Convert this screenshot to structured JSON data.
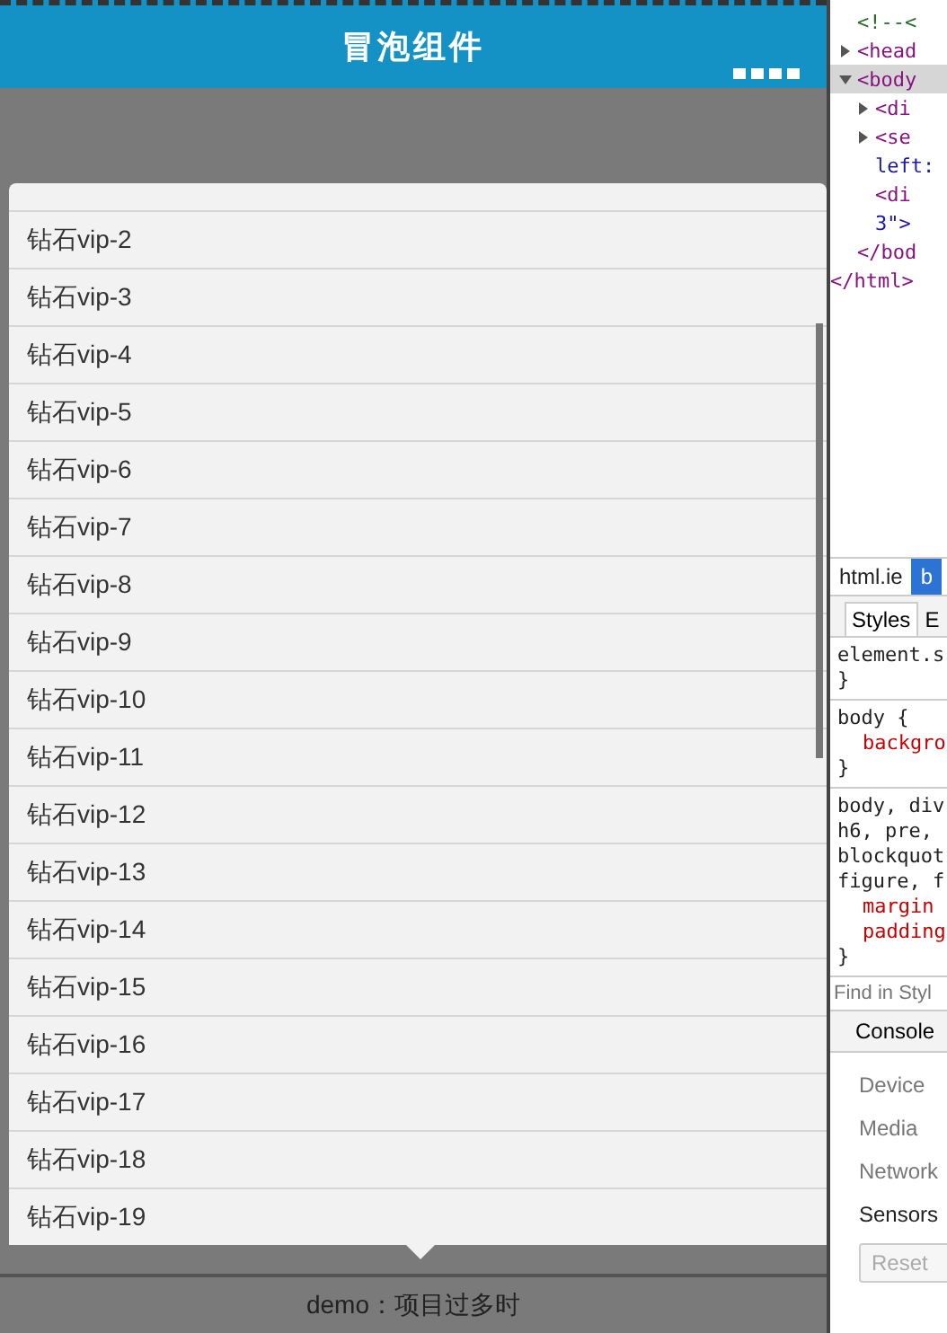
{
  "header": {
    "title": "冒泡组件"
  },
  "list": {
    "items": [
      "钻石vip-2",
      "钻石vip-3",
      "钻石vip-4",
      "钻石vip-5",
      "钻石vip-6",
      "钻石vip-7",
      "钻石vip-8",
      "钻石vip-9",
      "钻石vip-10",
      "钻石vip-11",
      "钻石vip-12",
      "钻石vip-13",
      "钻石vip-14",
      "钻石vip-15",
      "钻石vip-16",
      "钻石vip-17",
      "钻石vip-18",
      "钻石vip-19"
    ]
  },
  "footer": {
    "text": "demo：项目过多时"
  },
  "devtools": {
    "dom": {
      "nodes": [
        {
          "text": "<!--<",
          "kind": "comment"
        },
        {
          "text": "<head",
          "kind": "tag",
          "expanded": false,
          "selected": false
        },
        {
          "text": "<body",
          "kind": "tag",
          "expanded": true,
          "selected": true,
          "closing": "</bod",
          "children": [
            {
              "text": "<di",
              "kind": "tag",
              "expanded": false,
              "selected": false
            },
            {
              "text": "<se",
              "kind": "tag",
              "expanded": false,
              "selected": false
            },
            {
              "text": "left:",
              "kind": "attr"
            },
            {
              "text": "<di",
              "kind": "tag"
            },
            {
              "text": "3\">",
              "kind": "attr"
            }
          ]
        }
      ],
      "closing": "</html>"
    },
    "file_tabs": [
      {
        "label": "html.ie",
        "selected": false
      },
      {
        "label": "b",
        "selected": true
      }
    ],
    "panel_tabs": [
      {
        "label": "Styles",
        "selected": true
      },
      {
        "label": "E",
        "selected": false
      }
    ],
    "rules": [
      {
        "lines": [
          {
            "text": "element.s",
            "kind": "selector"
          },
          {
            "text": "}",
            "kind": "selector"
          }
        ]
      },
      {
        "lines": [
          {
            "text": "body {",
            "kind": "selector"
          },
          {
            "text": "backgro",
            "kind": "prop"
          },
          {
            "text": "}",
            "kind": "selector"
          }
        ]
      },
      {
        "lines": [
          {
            "text": "body, div",
            "kind": "selector"
          },
          {
            "text": "h6, pre,",
            "kind": "selector"
          },
          {
            "text": "blockquot",
            "kind": "selector"
          },
          {
            "text": "figure, f",
            "kind": "selector"
          },
          {
            "text": "margin",
            "kind": "prop"
          },
          {
            "text": "padding",
            "kind": "prop"
          },
          {
            "text": "}",
            "kind": "selector"
          }
        ]
      }
    ],
    "filter": {
      "placeholder": "Find in Styl"
    },
    "drawer_tab": "Console",
    "drawer_items": [
      {
        "label": "Device",
        "selected": false
      },
      {
        "label": "Media",
        "selected": false
      },
      {
        "label": "Network",
        "selected": false
      },
      {
        "label": "Sensors",
        "selected": true
      }
    ],
    "reset": "Reset"
  }
}
